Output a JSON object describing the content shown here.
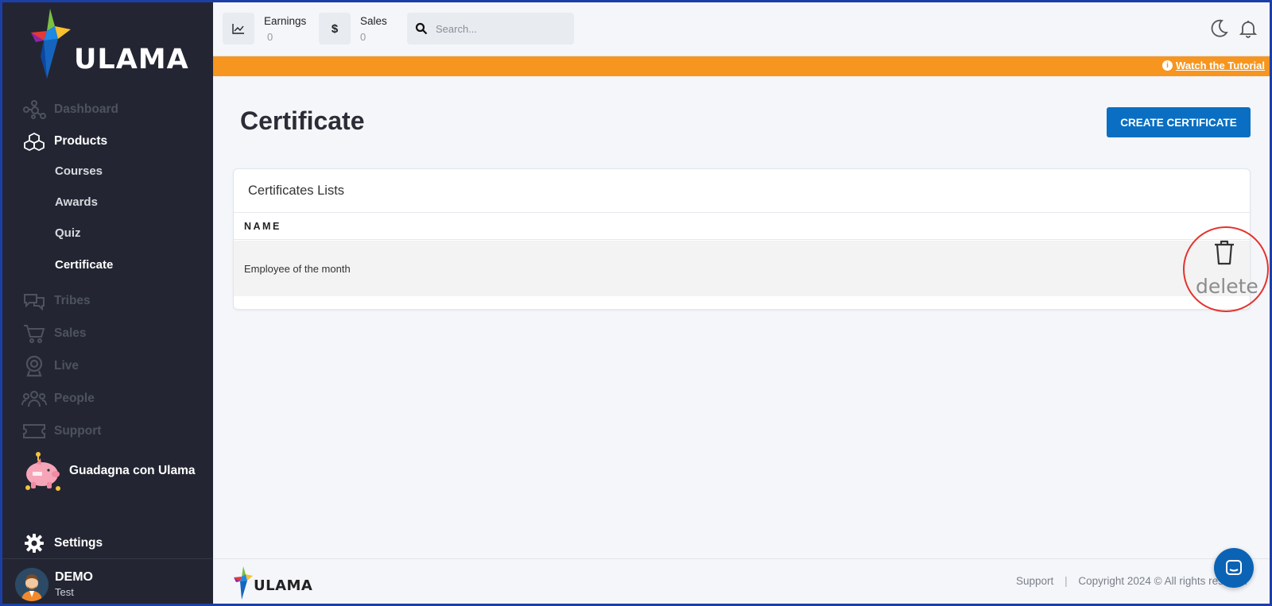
{
  "brand": {
    "name": "ULAMA"
  },
  "sidebar": {
    "items": [
      {
        "label": "Dashboard",
        "icon": "network-icon"
      },
      {
        "label": "Products",
        "icon": "cubes-icon"
      },
      {
        "label": "Tribes",
        "icon": "chat-bubbles-icon"
      },
      {
        "label": "Sales",
        "icon": "cart-icon"
      },
      {
        "label": "Live",
        "icon": "webcam-icon"
      },
      {
        "label": "People",
        "icon": "people-icon"
      },
      {
        "label": "Support",
        "icon": "ticket-icon"
      }
    ],
    "sub_items": [
      {
        "label": "Courses"
      },
      {
        "label": "Awards"
      },
      {
        "label": "Quiz"
      },
      {
        "label": "Certificate"
      }
    ],
    "promo": {
      "label": "Guadagna con Ulama",
      "icon": "piggy-bank-icon"
    },
    "settings": {
      "label": "Settings",
      "icon": "gear-icon"
    },
    "user": {
      "name": "DEMO",
      "role": "Test"
    }
  },
  "topbar": {
    "earnings": {
      "label": "Earnings",
      "value": "0",
      "icon": "chart-line-icon"
    },
    "sales": {
      "label": "Sales",
      "value": "0",
      "icon": "dollar-icon",
      "symbol": "$"
    },
    "search": {
      "placeholder": "Search..."
    }
  },
  "banner": {
    "link": "Watch the Tutorial",
    "info_symbol": "i",
    "color": "#f69620"
  },
  "main": {
    "title": "Certificate",
    "create_button": "CREATE CERTIFICATE",
    "card": {
      "title": "Certificates Lists",
      "columns": [
        "NAME"
      ],
      "rows": [
        {
          "name": "Employee of the month"
        }
      ]
    },
    "delete_label": "delete"
  },
  "footer": {
    "support": "Support",
    "separator": "|",
    "copyright": "Copyright 2024 © All rights reserved"
  },
  "colors": {
    "accent": "#0a6fc2",
    "sidebar": "#232632",
    "highlight": "#e4322c"
  }
}
